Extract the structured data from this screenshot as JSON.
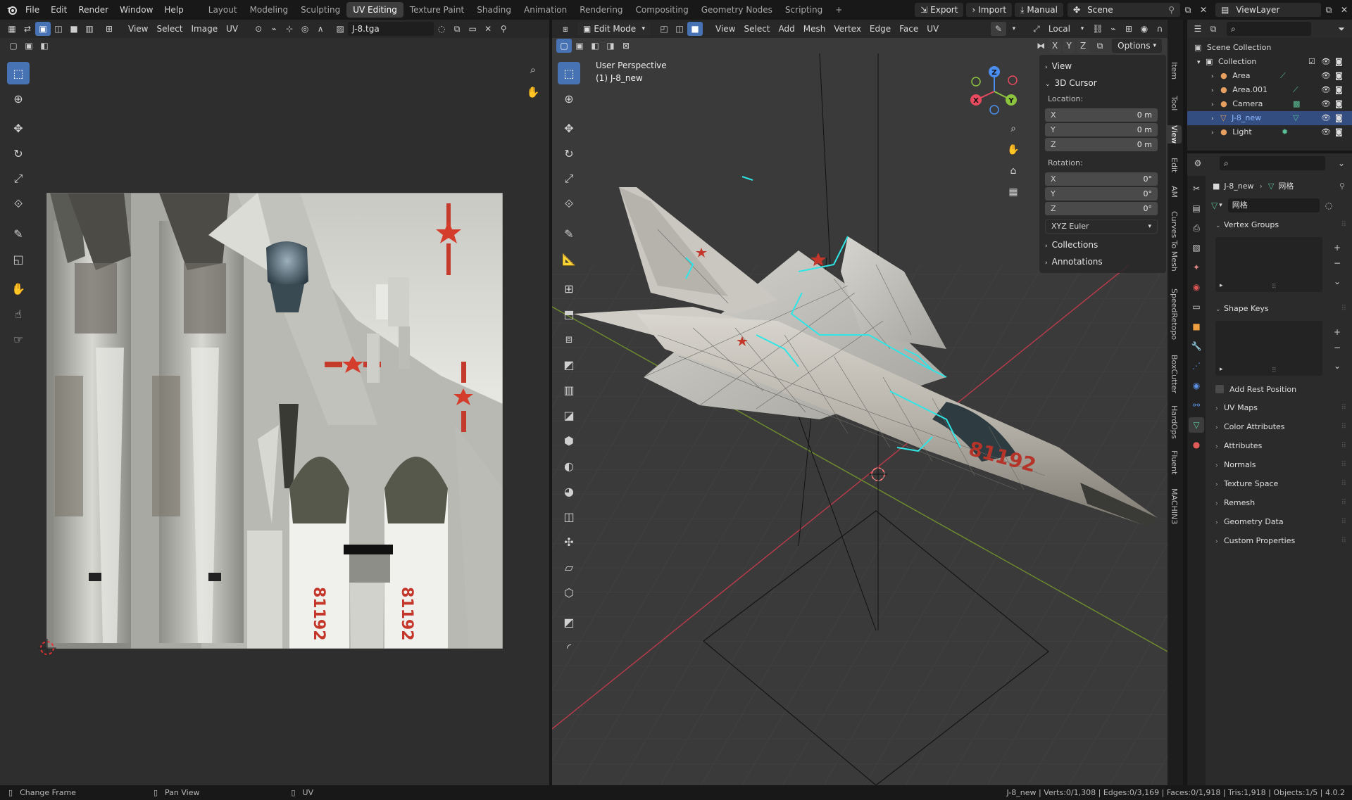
{
  "topbar": {
    "menus": [
      "File",
      "Edit",
      "Render",
      "Window",
      "Help"
    ],
    "workspaces": [
      "Layout",
      "Modeling",
      "Sculpting",
      "UV Editing",
      "Texture Paint",
      "Shading",
      "Animation",
      "Rendering",
      "Compositing",
      "Geometry Nodes",
      "Scripting"
    ],
    "active_workspace": "UV Editing",
    "add_tab": "+",
    "export_label": "Export",
    "import_label": "Import",
    "manual_label": "Manual",
    "scene_name": "Scene",
    "view_layer": "ViewLayer"
  },
  "uv_editor": {
    "menus": [
      "View",
      "Select",
      "Image",
      "UV"
    ],
    "image_name": "J-8.tga",
    "texture_texts": [
      "81192",
      "81192"
    ]
  },
  "viewport": {
    "mode": "Edit Mode",
    "menus": [
      "View",
      "Select",
      "Add",
      "Mesh",
      "Vertex",
      "Edge",
      "Face",
      "UV"
    ],
    "orientation": "Local",
    "axes": [
      "X",
      "Y",
      "Z"
    ],
    "options_label": "Options",
    "overlay_title": "User Perspective",
    "overlay_object": "(1) J-8_new",
    "aircraft_number": "81192",
    "gizmo": {
      "x": "X",
      "y": "Y",
      "z": "Z"
    }
  },
  "npanel": {
    "view_label": "View",
    "cursor_label": "3D Cursor",
    "location_label": "Location:",
    "location": [
      {
        "axis": "X",
        "value": "0 m"
      },
      {
        "axis": "Y",
        "value": "0 m"
      },
      {
        "axis": "Z",
        "value": "0 m"
      }
    ],
    "rotation_label": "Rotation:",
    "rotation": [
      {
        "axis": "X",
        "value": "0°"
      },
      {
        "axis": "Y",
        "value": "0°"
      },
      {
        "axis": "Z",
        "value": "0°"
      }
    ],
    "rotation_mode": "XYZ Euler",
    "collections_label": "Collections",
    "annotations_label": "Annotations",
    "side_tabs": [
      "Item",
      "Tool",
      "View",
      "Edit",
      "AM",
      "Curves To Mesh",
      "SpeedRetopo",
      "BoxCutter",
      "HardOps",
      "Fluent",
      "MACHIN3"
    ]
  },
  "outliner": {
    "root": "Scene Collection",
    "collection": "Collection",
    "items": [
      "Area",
      "Area.001",
      "Camera",
      "J-8_new",
      "Light"
    ],
    "selected": "J-8_new"
  },
  "properties": {
    "breadcrumb_object": "J-8_new",
    "breadcrumb_mesh": "网格",
    "mesh_name": "网格",
    "vertex_groups": "Vertex Groups",
    "shape_keys": "Shape Keys",
    "add_rest_position": "Add Rest Position",
    "sections": [
      "UV Maps",
      "Color Attributes",
      "Attributes",
      "Normals",
      "Texture Space",
      "Remesh",
      "Geometry Data",
      "Custom Properties"
    ]
  },
  "statusbar": {
    "change_frame": "Change Frame",
    "pan_view": "Pan View",
    "uv": "UV",
    "stats": "J-8_new | Verts:0/1,308 | Edges:0/3,169 | Faces:0/1,918 | Tris:1,918 | Objects:1/5 | 4.0.2"
  },
  "colors": {
    "accent": "#4772b3",
    "selection_outline": "#2ee6e6",
    "axis_x": "#e84a5f",
    "axis_y": "#8cc43f",
    "axis_z": "#4a8ff0"
  }
}
